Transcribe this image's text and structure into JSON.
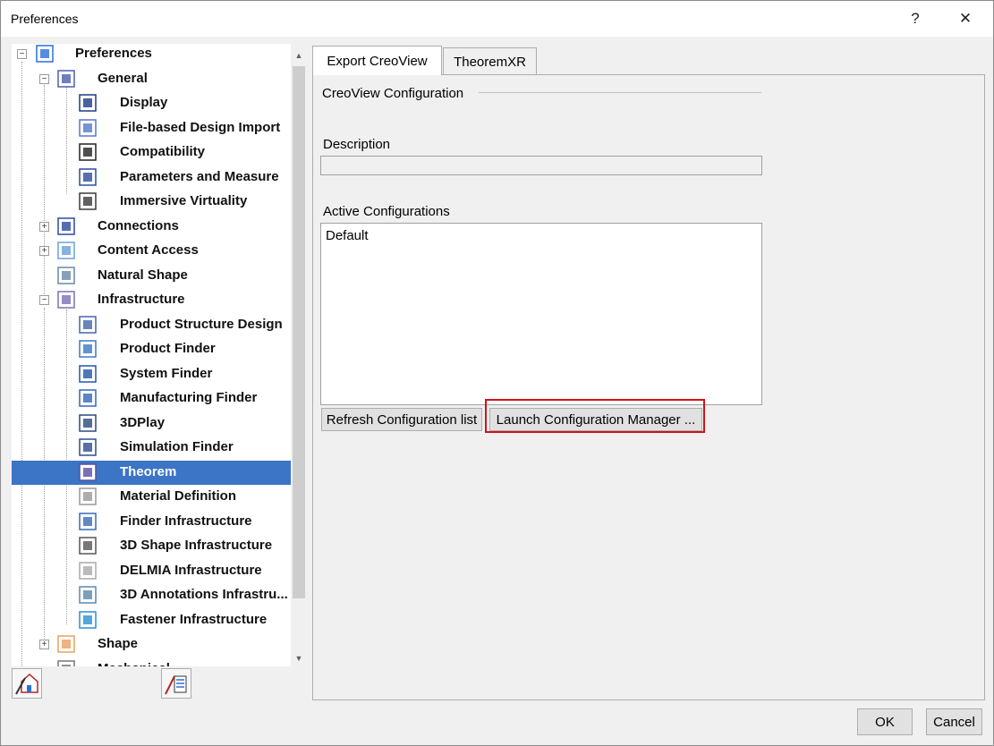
{
  "window": {
    "title": "Preferences",
    "help_glyph": "?",
    "close_glyph": "✕"
  },
  "tree": {
    "items": [
      {
        "label": "Preferences",
        "icon": "preferences-icon",
        "expander": "−"
      },
      {
        "label": "General",
        "icon": "general-icon",
        "expander": "−"
      },
      {
        "label": "Display",
        "icon": "display-icon"
      },
      {
        "label": "File-based Design Import",
        "icon": "file-import-icon"
      },
      {
        "label": "Compatibility",
        "icon": "compatibility-icon"
      },
      {
        "label": "Parameters and Measure",
        "icon": "parameters-icon"
      },
      {
        "label": "Immersive Virtuality",
        "icon": "immersive-icon"
      },
      {
        "label": "Connections",
        "icon": "connections-icon",
        "expander": "+"
      },
      {
        "label": "Content Access",
        "icon": "content-access-icon",
        "expander": "+"
      },
      {
        "label": "Natural Shape",
        "icon": "natural-shape-icon"
      },
      {
        "label": "Infrastructure",
        "icon": "infrastructure-icon",
        "expander": "−"
      },
      {
        "label": "Product Structure Design",
        "icon": "product-structure-icon"
      },
      {
        "label": "Product Finder",
        "icon": "product-finder-icon"
      },
      {
        "label": "System Finder",
        "icon": "system-finder-icon"
      },
      {
        "label": "Manufacturing Finder",
        "icon": "manufacturing-finder-icon"
      },
      {
        "label": "3DPlay",
        "icon": "play-icon"
      },
      {
        "label": "Simulation Finder",
        "icon": "simulation-finder-icon"
      },
      {
        "label": "Theorem",
        "icon": "theorem-icon",
        "selected": true
      },
      {
        "label": "Material Definition",
        "icon": "material-icon"
      },
      {
        "label": "Finder Infrastructure",
        "icon": "finder-infra-icon"
      },
      {
        "label": "3D Shape Infrastructure",
        "icon": "shape-infra-icon"
      },
      {
        "label": "DELMIA Infrastructure",
        "icon": "delmia-icon"
      },
      {
        "label": "3D Annotations Infrastru...",
        "icon": "annotations-icon"
      },
      {
        "label": "Fastener Infrastructure",
        "icon": "fastener-icon"
      },
      {
        "label": "Shape",
        "icon": "shape-icon",
        "expander": "+"
      },
      {
        "label": "Mechanical",
        "icon": "mechanical-icon"
      }
    ]
  },
  "tabs": [
    {
      "label": "Export CreoView",
      "active": true
    },
    {
      "label": "TheoremXR",
      "active": false
    }
  ],
  "panel": {
    "group_title": "CreoView Configuration",
    "description_label": "Description",
    "description_value": "",
    "active_label": "Active Configurations",
    "active_items": [
      "Default"
    ],
    "refresh_button": "Refresh Configuration list",
    "launch_button": "Launch Configuration Manager ..."
  },
  "footer": {
    "ok": "OK",
    "cancel": "Cancel"
  },
  "colors": {
    "selection": "#3c74c6",
    "highlight_box": "#d0121e"
  }
}
